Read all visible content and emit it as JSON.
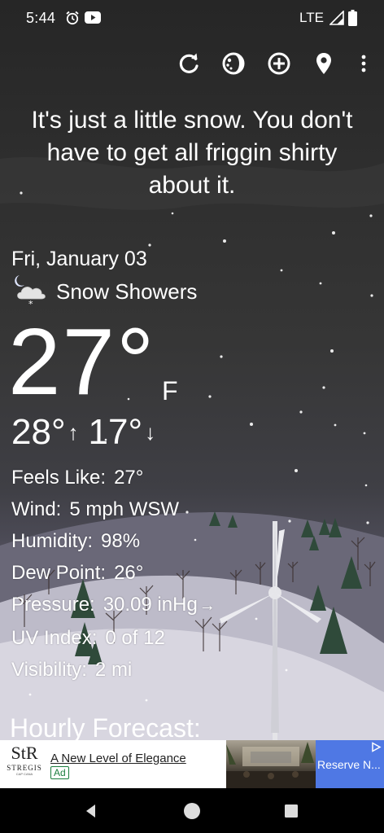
{
  "status_bar": {
    "time": "5:44",
    "network": "LTE",
    "icons": [
      "alarm-icon",
      "youtube-icon",
      "signal-icon",
      "battery-icon"
    ]
  },
  "toolbar": {
    "icons": [
      "refresh-icon",
      "theme-icon",
      "add-location-icon",
      "location-pin-icon",
      "more-options-icon"
    ]
  },
  "quote": "It's just a little snow. You don't have to get all friggin shirty about it.",
  "weather": {
    "date": "Fri, January 03",
    "condition_icon": "snow-showers-night-icon",
    "condition": "Snow Showers",
    "temperature": "27°",
    "unit": "F",
    "high": "28°",
    "high_arrow": "↑",
    "low": "17°",
    "low_arrow": "↓"
  },
  "details": {
    "feels_like": {
      "label": "Feels Like:",
      "value": "27°"
    },
    "wind": {
      "label": "Wind:",
      "value": "5 mph WSW"
    },
    "humidity": {
      "label": "Humidity:",
      "value": "98%"
    },
    "dew_point": {
      "label": "Dew Point:",
      "value": "26°"
    },
    "pressure": {
      "label": "Pressure:",
      "value": "30.09 inHg",
      "trend": "→"
    },
    "uv_index": {
      "label": "UV Index:",
      "value": "0 of 12"
    },
    "visibility": {
      "label": "Visibility:",
      "value": "2 mi"
    }
  },
  "hourly_heading": "Hourly Forecast:",
  "ad": {
    "logo_monogram": "StR",
    "logo_brand": "STREGIS",
    "logo_sub": "CAP CANA",
    "title": "A New Level of Elegance",
    "badge": "Ad",
    "cta": "Reserve N...",
    "cta_color": "#4f78e4"
  },
  "nav_bar": {
    "icons": [
      "back-icon",
      "home-icon",
      "recents-icon"
    ]
  }
}
